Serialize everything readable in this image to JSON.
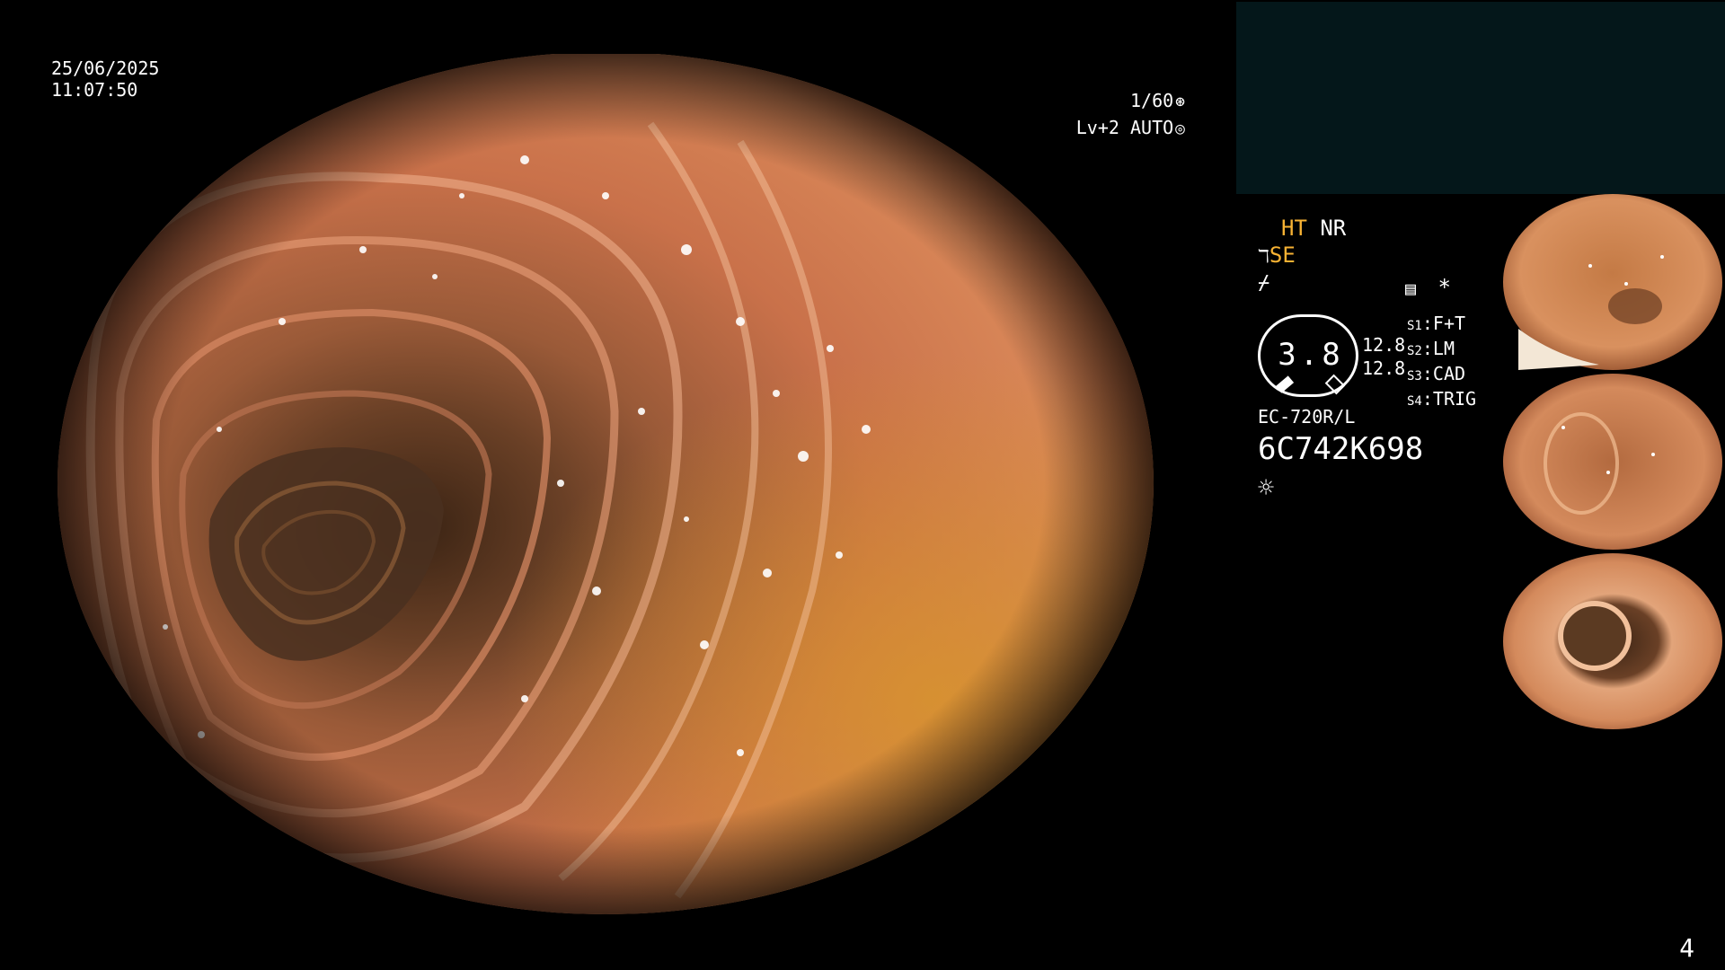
{
  "datetime": {
    "date": "25/06/2025",
    "time": "11:07:50"
  },
  "exposure": {
    "shutter": "1/60",
    "shutter_icon": "aperture-icon",
    "level": "Lv+2",
    "mode": "AUTO",
    "mode_icon": "auto-iris-icon"
  },
  "modes": {
    "ht": "HT",
    "nr": "NR",
    "se": "SE",
    "se_icon": "enhance-icon",
    "freeze_icon": "freeze-icon",
    "memory_icon": "memory-icon",
    "asterisk": "*"
  },
  "zoom": {
    "value": "3.8",
    "scale_top": "12.8",
    "scale_bottom": "12.8"
  },
  "switches": [
    {
      "key": "S1",
      "value": "F+T"
    },
    {
      "key": "S2",
      "value": "LM"
    },
    {
      "key": "S3",
      "value": "CAD"
    },
    {
      "key": "S4",
      "value": "TRIG"
    }
  ],
  "scope": {
    "model": "EC-720R/L",
    "serial": "6C742K698",
    "light_icon": "light-source-icon"
  },
  "page_number": "4",
  "colors": {
    "accent_yellow": "#f7b233",
    "panel_teal": "#04171a",
    "tissue": "#c9714a"
  }
}
